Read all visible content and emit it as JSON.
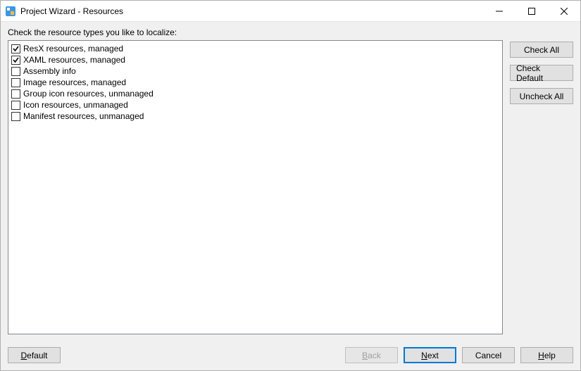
{
  "window": {
    "title": "Project Wizard - Resources"
  },
  "instruction": "Check the resource types you like to localize:",
  "resources": [
    {
      "label": "ResX resources, managed",
      "checked": true
    },
    {
      "label": "XAML resources, managed",
      "checked": true
    },
    {
      "label": "Assembly info",
      "checked": false
    },
    {
      "label": "Image resources, managed",
      "checked": false
    },
    {
      "label": "Group icon resources, unmanaged",
      "checked": false
    },
    {
      "label": "Icon resources, unmanaged",
      "checked": false
    },
    {
      "label": "Manifest resources, unmanaged",
      "checked": false
    }
  ],
  "side_buttons": {
    "check_all": "Check All",
    "check_default": "Check Default",
    "uncheck_all": "Uncheck All"
  },
  "footer": {
    "default_label": "efault",
    "default_mn": "D",
    "back_label": "ack",
    "back_mn": "B",
    "next_label": "ext",
    "next_mn": "N",
    "cancel_label": "Cancel",
    "help_label": "elp",
    "help_mn": "H"
  }
}
